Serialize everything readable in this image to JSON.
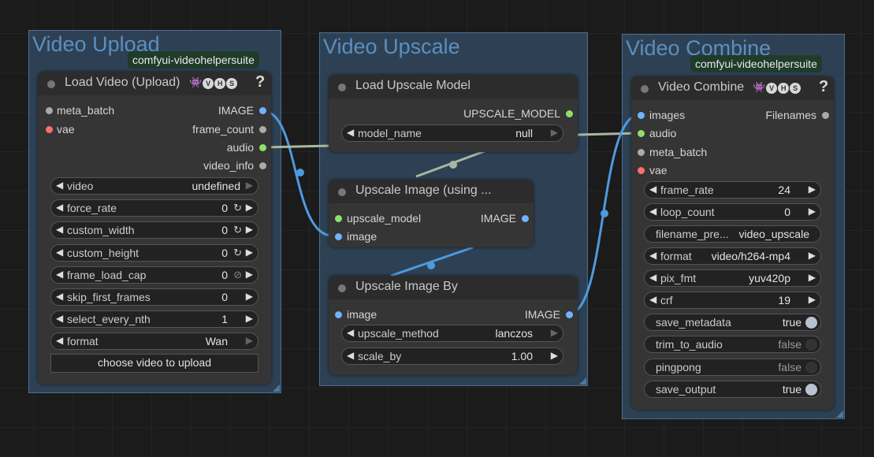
{
  "colors": {
    "image": "#6fb3ff",
    "audio": "#8ee06a",
    "vae": "#ff6e6e",
    "other": "#aaaaaa",
    "link_image": "#4e9ae0",
    "link_other": "#a8b8a0",
    "group": "#2e4154"
  },
  "groups": {
    "upload": "Video Upload",
    "upscale": "Video Upscale",
    "combine": "Video Combine"
  },
  "badges": {
    "upload": "comfyui-videohelpersuite",
    "combine": "comfyui-videohelpersuite"
  },
  "load_video": {
    "title": "Load Video (Upload)",
    "vhs_icons": [
      "V",
      "H",
      "S"
    ],
    "help": "?",
    "inputs": [
      "meta_batch",
      "vae"
    ],
    "outputs": [
      "IMAGE",
      "frame_count",
      "audio",
      "video_info"
    ],
    "widgets": [
      {
        "label": "video",
        "value": "undefined"
      },
      {
        "label": "force_rate",
        "value": "0"
      },
      {
        "label": "custom_width",
        "value": "0"
      },
      {
        "label": "custom_height",
        "value": "0"
      },
      {
        "label": "frame_load_cap",
        "value": "0"
      },
      {
        "label": "skip_first_frames",
        "value": "0"
      },
      {
        "label": "select_every_nth",
        "value": "1"
      },
      {
        "label": "format",
        "value": "Wan"
      }
    ],
    "upload_button": "choose video to upload"
  },
  "load_upscale_model": {
    "title": "Load Upscale Model",
    "output": "UPSCALE_MODEL",
    "widget": {
      "label": "model_name",
      "value": "null"
    }
  },
  "upscale_image_using": {
    "title": "Upscale Image (using ...",
    "inputs": [
      "upscale_model",
      "image"
    ],
    "output": "IMAGE"
  },
  "upscale_image_by": {
    "title": "Upscale Image By",
    "input": "image",
    "output": "IMAGE",
    "widgets": [
      {
        "label": "upscale_method",
        "value": "lanczos"
      },
      {
        "label": "scale_by",
        "value": "1.00"
      }
    ]
  },
  "video_combine": {
    "title": "Video Combine",
    "vhs_icons": [
      "V",
      "H",
      "S"
    ],
    "help": "?",
    "inputs": [
      "images",
      "audio",
      "meta_batch",
      "vae"
    ],
    "output": "Filenames",
    "widgets": [
      {
        "label": "frame_rate",
        "value": "24"
      },
      {
        "label": "loop_count",
        "value": "0"
      },
      {
        "label": "filename_pre...",
        "value": "video_upscale"
      },
      {
        "label": "format",
        "value": "video/h264-mp4"
      },
      {
        "label": "pix_fmt",
        "value": "yuv420p"
      },
      {
        "label": "crf",
        "value": "19"
      }
    ],
    "toggles": [
      {
        "label": "save_metadata",
        "value": "true"
      },
      {
        "label": "trim_to_audio",
        "value": "false"
      },
      {
        "label": "pingpong",
        "value": "false"
      },
      {
        "label": "save_output",
        "value": "true"
      }
    ]
  }
}
